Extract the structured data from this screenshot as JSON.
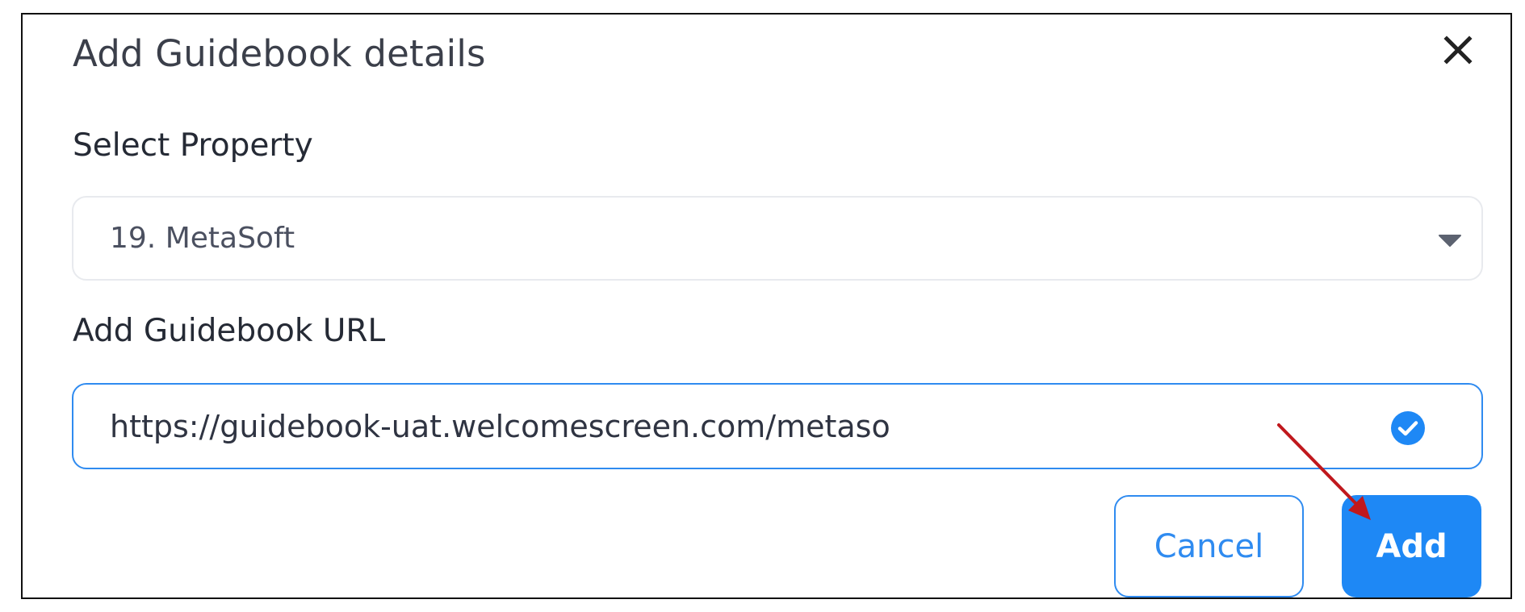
{
  "dialog": {
    "title": "Add Guidebook details",
    "close_icon": "close-icon"
  },
  "property": {
    "label": "Select Property",
    "selected_value": "19. MetaSoft",
    "dropdown_icon": "chevron-down-icon"
  },
  "guidebook_url": {
    "label": "Add Guidebook URL",
    "value": "https://guidebook-uat.welcomescreen.com/metaso",
    "status_icon": "check-circle-icon"
  },
  "buttons": {
    "cancel_label": "Cancel",
    "add_label": "Add"
  },
  "colors": {
    "accent": "#1e88f5",
    "annotation_arrow": "#c0181d"
  }
}
